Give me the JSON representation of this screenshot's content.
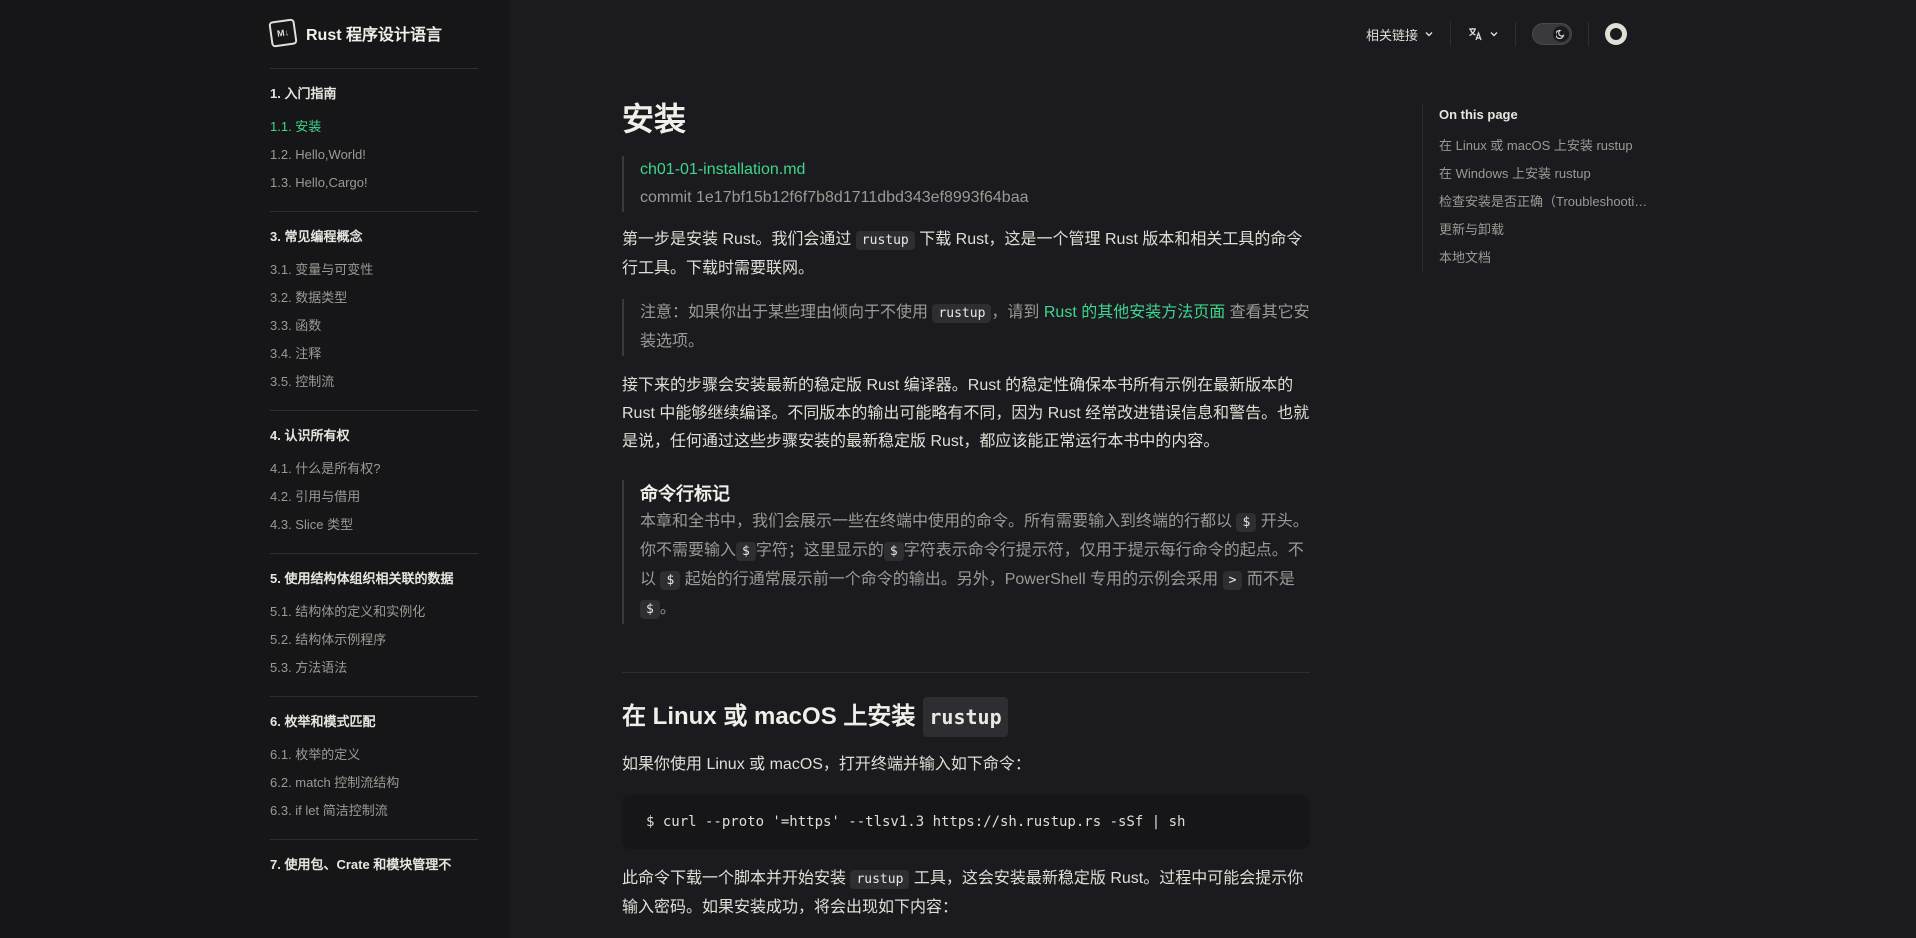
{
  "brand": {
    "logo_text": "M↓",
    "title": "Rust 程序设计语言"
  },
  "nav": [
    {
      "title": "1. 入门指南",
      "items": [
        {
          "label": "1.1. 安装",
          "active": true
        },
        {
          "label": "1.2. Hello,World!"
        },
        {
          "label": "1.3. Hello,Cargo!"
        }
      ]
    },
    {
      "title": "3. 常见编程概念",
      "items": [
        {
          "label": "3.1. 变量与可变性"
        },
        {
          "label": "3.2. 数据类型"
        },
        {
          "label": "3.3. 函数"
        },
        {
          "label": "3.4. 注释"
        },
        {
          "label": "3.5. 控制流"
        }
      ]
    },
    {
      "title": "4. 认识所有权",
      "items": [
        {
          "label": "4.1. 什么是所有权?"
        },
        {
          "label": "4.2. 引用与借用"
        },
        {
          "label": "4.3. Slice 类型"
        }
      ]
    },
    {
      "title": "5. 使用结构体组织相关联的数据",
      "items": [
        {
          "label": "5.1. 结构体的定义和实例化"
        },
        {
          "label": "5.2. 结构体示例程序"
        },
        {
          "label": "5.3. 方法语法"
        }
      ]
    },
    {
      "title": "6. 枚举和模式匹配",
      "items": [
        {
          "label": "6.1. 枚举的定义"
        },
        {
          "label": "6.2. match 控制流结构"
        },
        {
          "label": "6.3. if let 简洁控制流"
        }
      ]
    },
    {
      "title": "7. 使用包、Crate 和模块管理不",
      "items": []
    }
  ],
  "topbar": {
    "related_links": "相关链接",
    "lang_icon": "translate-icon",
    "theme_icon": "moon-icon",
    "github_icon": "github-icon"
  },
  "main": {
    "title": "安装",
    "meta_file": "ch01-01-installation.md",
    "meta_commit": "commit 1e17bf15b12f6f7b8d1711dbd343ef8993f64baa",
    "p1_a": "第一步是安装 Rust。我们会通过 ",
    "p1_code": "rustup",
    "p1_b": " 下载 Rust，这是一个管理 Rust 版本和相关工具的命令行工具。下载时需要联网。",
    "note_a": "注意：如果你出于某些理由倾向于不使用 ",
    "note_code": "rustup",
    "note_b": "，请到 ",
    "note_link": "Rust 的其他安装方法页面",
    "note_c": " 查看其它安装选项。",
    "p2": "接下来的步骤会安装最新的稳定版 Rust 编译器。Rust 的稳定性确保本书所有示例在最新版本的 Rust 中能够继续编译。不同版本的输出可能略有不同，因为 Rust 经常改进错误信息和警告。也就是说，任何通过这些步骤安装的最新稳定版 Rust，都应该能正常运行本书中的内容。",
    "callout_title": "命令行标记",
    "callout_a": "本章和全书中，我们会展示一些在终端中使用的命令。所有需要输入到终端的行都以 ",
    "callout_code1": "$",
    "callout_b": " 开头。你不需要输入",
    "callout_code2": "$",
    "callout_c": "字符；这里显示的",
    "callout_code3": "$",
    "callout_d": "字符表示命令行提示符，仅用于提示每行命令的起点。不以 ",
    "callout_code4": "$",
    "callout_e": " 起始的行通常展示前一个命令的输出。另外，PowerShell 专用的示例会采用 ",
    "callout_code5": ">",
    "callout_f": " 而不是 ",
    "callout_code6": "$",
    "callout_g": "。",
    "h2_text": "在 Linux 或 macOS 上安装 ",
    "h2_code": "rustup",
    "p3": "如果你使用 Linux 或 macOS，打开终端并输入如下命令：",
    "code_cmd": "$ curl --proto '=https' --tlsv1.3 https://sh.rustup.rs -sSf | sh",
    "p4_a": "此命令下载一个脚本并开始安装 ",
    "p4_code": "rustup",
    "p4_b": " 工具，这会安装最新稳定版 Rust。过程中可能会提示你输入密码。如果安装成功，将会出现如下内容："
  },
  "outline": {
    "title": "On this page",
    "items": [
      "在 Linux 或 macOS 上安装 rustup",
      "在 Windows 上安装 rustup",
      "检查安装是否正确（Troubleshooting）",
      "更新与卸载",
      "本地文档"
    ]
  }
}
